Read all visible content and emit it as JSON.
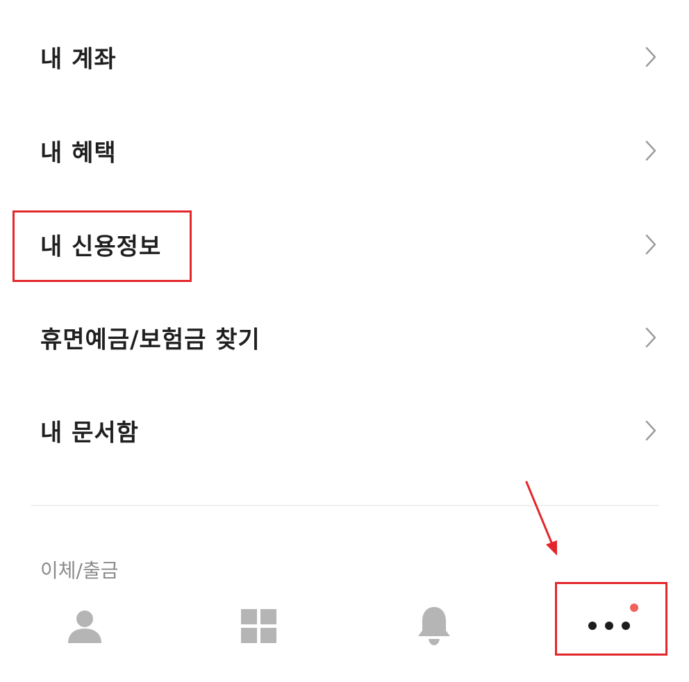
{
  "menu": {
    "items": [
      {
        "label": "내 계좌"
      },
      {
        "label": "내 혜택"
      },
      {
        "label": "내 신용정보"
      },
      {
        "label": "휴면예금/보험금 찾기"
      },
      {
        "label": "내 문서함"
      }
    ]
  },
  "section": {
    "transfer_header": "이체/출금"
  },
  "tab_bar": {
    "tabs": [
      {
        "icon": "person-icon"
      },
      {
        "icon": "grid-icon"
      },
      {
        "icon": "bell-icon"
      },
      {
        "icon": "more-dots-icon",
        "has_badge": true
      }
    ]
  },
  "colors": {
    "text_primary": "#1f1f1f",
    "text_secondary": "#8a8a8a",
    "chevron": "#9a9a9a",
    "tab_icon": "#b5b5b5",
    "badge": "#f0625a",
    "annotation": "#e3262b"
  }
}
